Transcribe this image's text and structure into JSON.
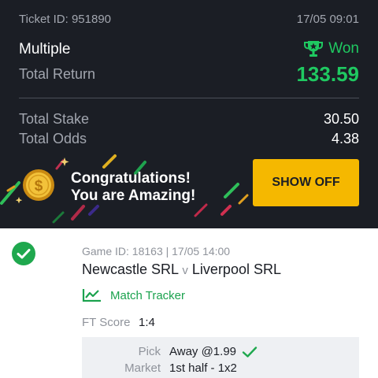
{
  "ticket": {
    "id_text": "Ticket ID: 951890",
    "date": "17/05 09:01",
    "bet_type": "Multiple",
    "status": "Won",
    "total_return_label": "Total Return",
    "total_return": "133.59",
    "total_stake_label": "Total Stake",
    "total_stake": "30.50",
    "total_odds_label": "Total Odds",
    "total_odds": "4.38"
  },
  "banner": {
    "line1": "Congratulations!",
    "line2": "You are Amazing!",
    "button_label": "SHOW OFF"
  },
  "selection": {
    "game_meta": "Game ID: 18163 | 17/05 14:00",
    "home_team": "Newcastle SRL",
    "vs": "v",
    "away_team": "Liverpool SRL",
    "tracker_label": "Match Tracker",
    "ft_score_label": "FT Score",
    "ft_score": "1:4",
    "pick_label": "Pick",
    "pick_value": "Away @1.99",
    "market_label": "Market",
    "market_value": "1st half - 1x2"
  },
  "icons": {
    "trophy": "trophy-icon",
    "coin": "coin-icon",
    "check_circle": "check-circle-icon",
    "tracker": "line-chart-icon",
    "check": "check-icon"
  },
  "colors": {
    "header_bg": "#1b1e25",
    "win_green": "#1fc961",
    "button_yellow": "#f5b800",
    "muted_text": "#a2a6af"
  }
}
